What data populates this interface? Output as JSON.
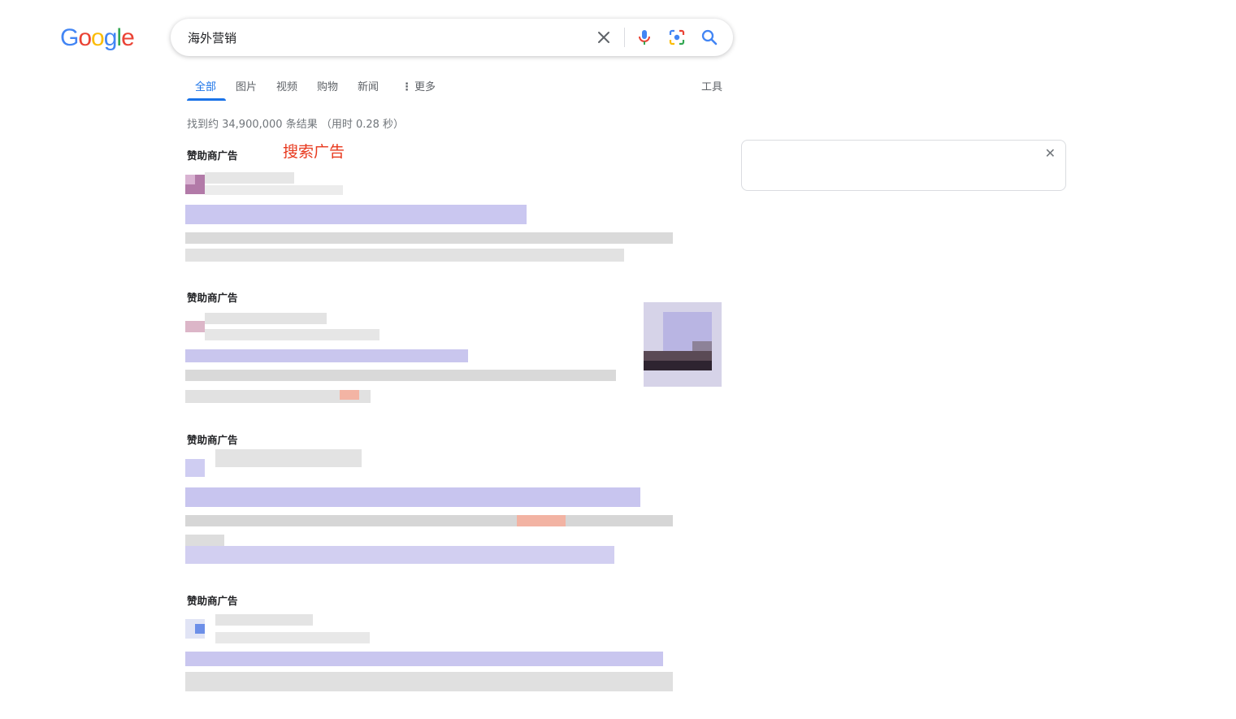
{
  "logo": {
    "letters": [
      "G",
      "o",
      "o",
      "g",
      "l",
      "e"
    ],
    "colors": [
      "#4285F4",
      "#EA4335",
      "#FBBC05",
      "#4285F4",
      "#34A853",
      "#EA4335"
    ]
  },
  "search": {
    "query": "海外营销"
  },
  "tabs": [
    "全部",
    "图片",
    "视频",
    "购物",
    "新闻",
    "更多",
    "工具"
  ],
  "stats": "找到约 34,900,000 条结果 （用时 0.28 秒）",
  "annotation": "搜索广告",
  "sponsored_label": "赞助商广告",
  "colors": {
    "accent": "#1a73e8",
    "annotation": "#e8391e",
    "ad_link_blur": "#c7c4ef",
    "ad_text_blur": "#dcdcdc"
  }
}
